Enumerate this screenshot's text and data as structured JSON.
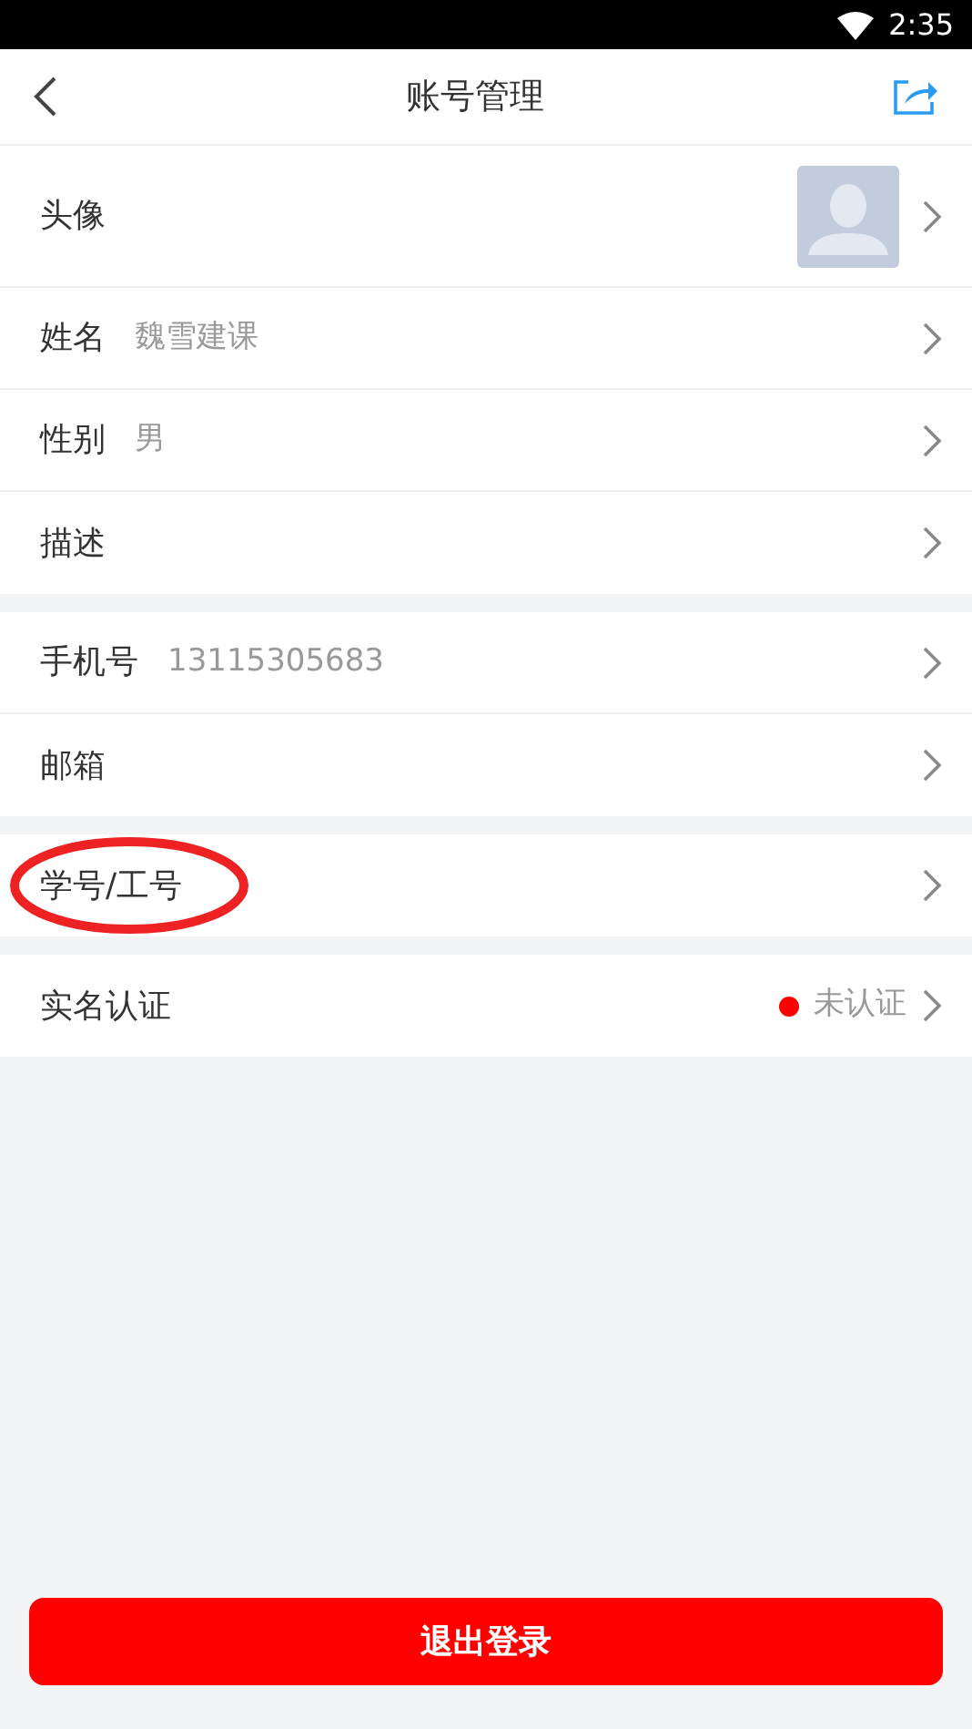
{
  "status_bar": {
    "time": "2:35"
  },
  "header": {
    "title": "账号管理"
  },
  "groups": [
    {
      "rows": [
        {
          "kind": "avatar",
          "label": "头像",
          "highlighted": false
        },
        {
          "kind": "text",
          "label": "姓名",
          "value": "魏雪建课",
          "highlighted": false
        },
        {
          "kind": "text",
          "label": "性别",
          "value": "男",
          "highlighted": false
        },
        {
          "kind": "text",
          "label": "描述",
          "highlighted": false
        }
      ]
    },
    {
      "rows": [
        {
          "kind": "text",
          "label": "手机号",
          "value": "13115305683",
          "highlighted": false
        },
        {
          "kind": "text",
          "label": "邮箱",
          "highlighted": false
        }
      ]
    },
    {
      "rows": [
        {
          "kind": "text",
          "label": "学号/工号",
          "highlighted": true
        }
      ]
    },
    {
      "rows": [
        {
          "kind": "status",
          "label": "实名认证",
          "status": "未认证",
          "color": "#ff0000",
          "highlighted": false
        }
      ]
    }
  ],
  "logout_button": "退出登录"
}
